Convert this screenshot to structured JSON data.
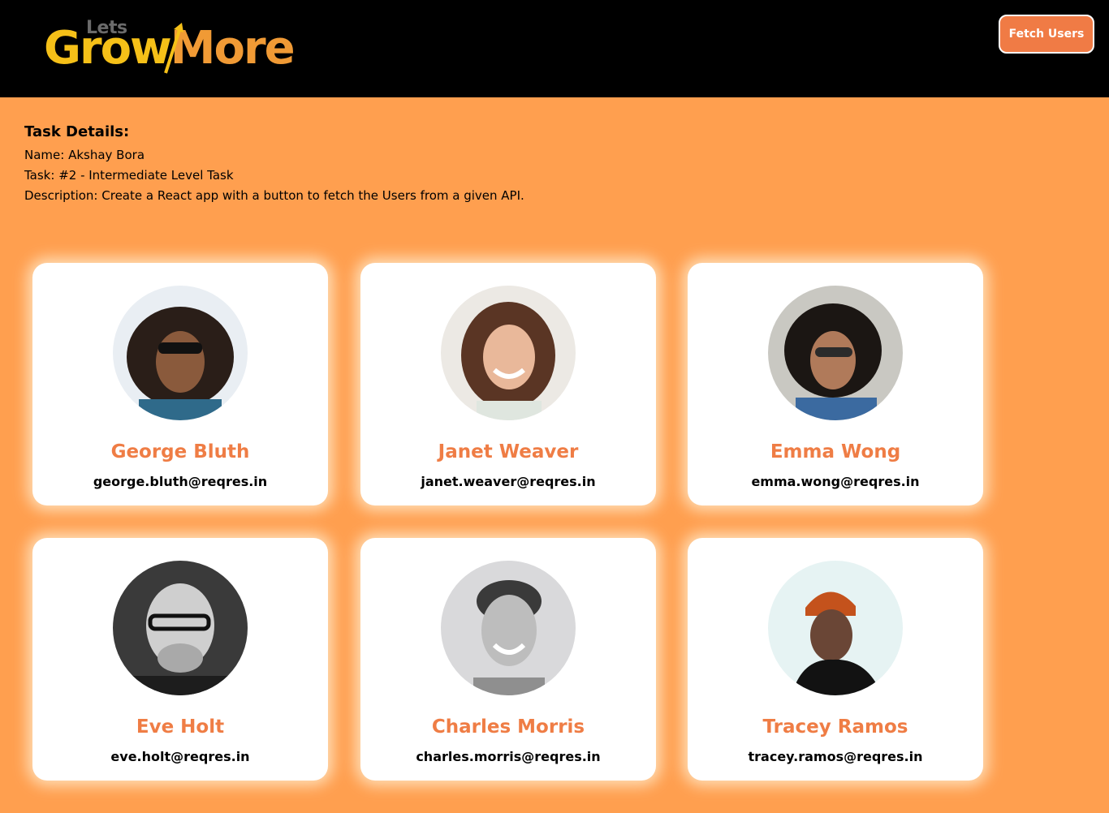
{
  "header": {
    "logo": {
      "lets": "Lets",
      "grow": "Grow",
      "more": "More"
    },
    "fetch_button_label": "Fetch Users"
  },
  "task": {
    "title": "Task Details:",
    "name_line": "Name: Akshay Bora",
    "task_line": "Task: #2 - Intermediate Level Task",
    "description_line": "Description: Create a React app with a button to fetch the Users from a given API."
  },
  "users": [
    {
      "name": "George Bluth",
      "email": "george.bluth@reqres.in"
    },
    {
      "name": "Janet Weaver",
      "email": "janet.weaver@reqres.in"
    },
    {
      "name": "Emma Wong",
      "email": "emma.wong@reqres.in"
    },
    {
      "name": "Eve Holt",
      "email": "eve.holt@reqres.in"
    },
    {
      "name": "Charles Morris",
      "email": "charles.morris@reqres.in"
    },
    {
      "name": "Tracey Ramos",
      "email": "tracey.ramos@reqres.in"
    }
  ],
  "colors": {
    "page_background": "#ff9f4f",
    "header_background": "#000000",
    "accent": "#ef7d45",
    "logo_yellow": "#f5c018",
    "logo_orange": "#f09a35"
  }
}
